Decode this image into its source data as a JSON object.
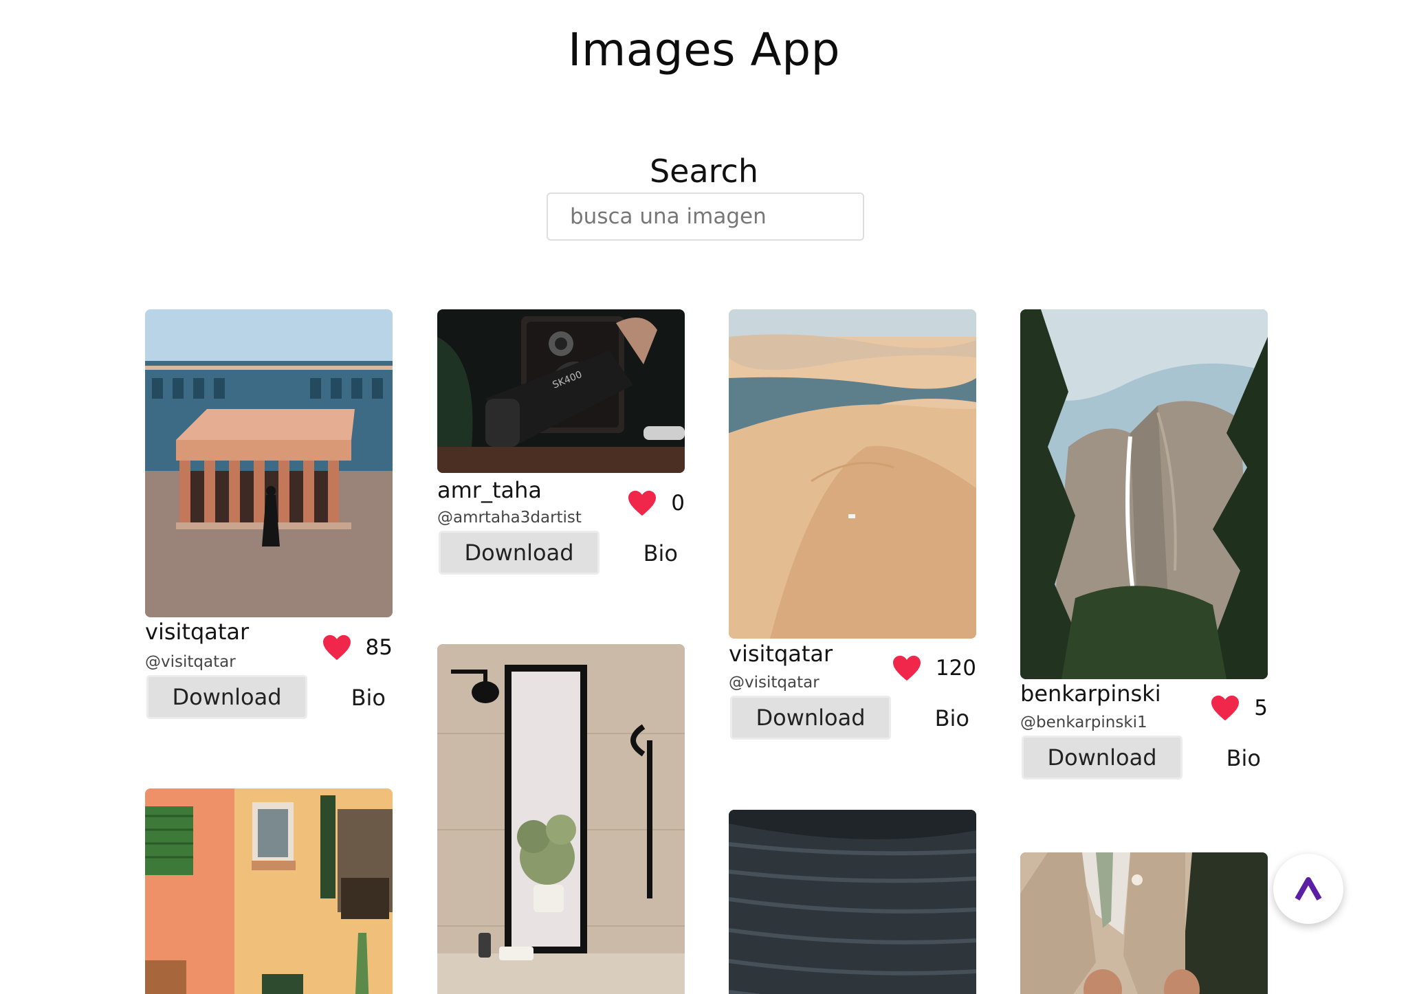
{
  "app": {
    "title": "Images App"
  },
  "search": {
    "label": "Search",
    "placeholder": "busca una imagen",
    "value": ""
  },
  "actions": {
    "download_label": "Download",
    "bio_label": "Bio"
  },
  "colors": {
    "heart": "#f0264a",
    "accent": "#5b1fa3"
  },
  "cards": [
    {
      "name": "visitqatar",
      "handle": "@visitqatar",
      "likes": "85"
    },
    {
      "name": "amr_taha",
      "handle": "@amrtaha3dartist",
      "likes": "0"
    },
    {
      "name": "visitqatar",
      "handle": "@visitqatar",
      "likes": "120"
    },
    {
      "name": "benkarpinski",
      "handle": "@benkarpinski1",
      "likes": "5"
    }
  ],
  "scroll_top": {
    "icon": "chevron-up-icon"
  }
}
